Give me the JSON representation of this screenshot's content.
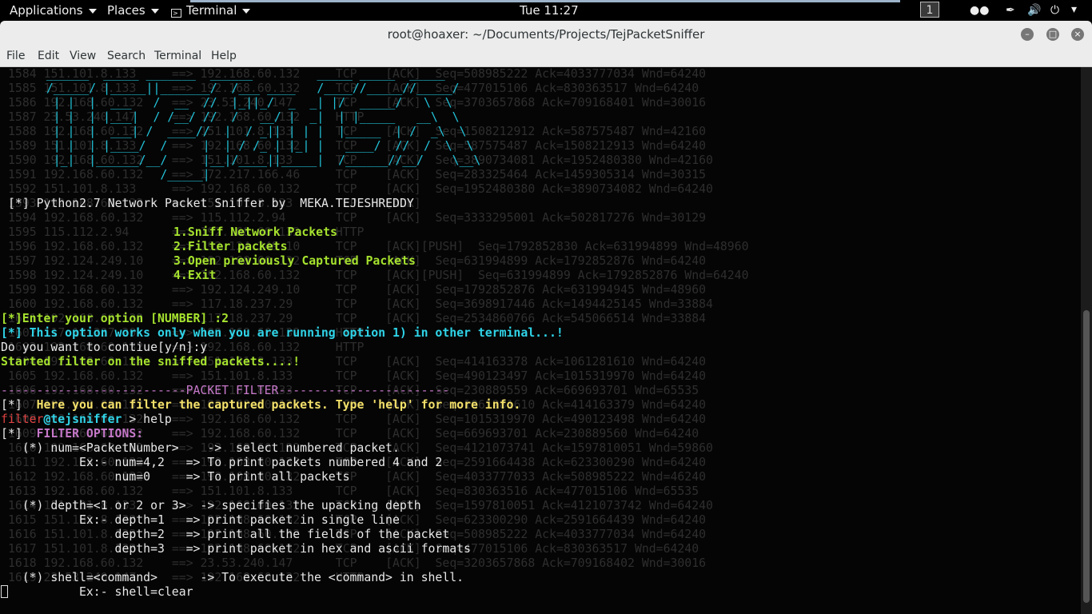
{
  "topbar": {
    "applications": "Applications",
    "places": "Places",
    "terminal": "Terminal",
    "clock": "Tue 11:27",
    "workspace": "1"
  },
  "window": {
    "title": "root@hoaxer: ~/Documents/Projects/TejPacketSniffer",
    "menus": [
      "File",
      "Edit",
      "View",
      "Search",
      "Terminal",
      "Help"
    ]
  },
  "background_rows": [
    "1584 151.101.8.133     ==> 192.168.60.132     TCP    [ACK]  Seq=508985222 Ack=4033777034 Wnd=64240",
    "1585 151.101.8.133     ==> 192.168.60.132     TCP    [ACK]  Seq=477015106 Ack=830363517 Wnd=64240",
    "1586 192.168.60.132    ==> 23.53.240.147      TCP    [ACK]  Seq=3703657868 Ack=709168401 Wnd=30016",
    "1587 23.53.240.147     ==> 192.168.60.132     HTTP",
    "1588 192.168.60.132    ==> 151.101.8.133      TCP    [ACK]  Seq=1508212912 Ack=587575487 Wnd=42160",
    "1589 151.101.8.133     ==> 192.168.60.132     TCP    [ACK]  Seq=587575487 Ack=1508212913 Wnd=64240",
    "1590 192.168.60.132    ==> 151.101.8.133      TCP    [ACK]  Seq=3890734081 Ack=1952480380 Wnd=42160",
    "1591 192.168.60.132    ==> 172.217.166.46     TCP    [ACK]  Seq=283325464 Ack=1459305314 Wnd=30315",
    "1592 151.101.8.133     ==> 192.168.60.132     TCP    [ACK]  Seq=1952480380 Ack=3890734082 Wnd=64240",
    "1593 192.168.60.132    ==> 151.101.8.133      TCP    [ACK]",
    "1594 192.168.60.132    ==> 115.112.2.94       TCP    [ACK]  Seq=3333295001 Ack=502817276 Wnd=30129",
    "1595 115.112.2.94      ==> 192.168.60.132     HTTP",
    "1596 192.168.60.132    ==> 192.124.249.10     TCP    [ACK][PUSH]  Seq=1792852830 Ack=631994899 Wnd=48960",
    "1597 192.124.249.10    ==> 192.168.60.132     TCP    [ACK]  Seq=631994899 Ack=1792852876 Wnd=64240",
    "1598 192.124.249.10    ==> 192.168.60.132     TCP    [ACK][PUSH]  Seq=631994899 Ack=1792852876 Wnd=64240",
    "1599 192.168.60.132    ==> 192.124.249.10     TCP    [ACK]  Seq=1792852876 Ack=631994945 Wnd=48960",
    "1600 192.168.60.132    ==> 117.18.237.29      TCP    [ACK]  Seq=3698917446 Ack=1494425145 Wnd=33884",
    "1601 192.168.60.132    ==> 117.18.237.29      TCP    [ACK]  Seq=2534860766 Ack=545066514 Wnd=33884",
    "1602 117.18.237.29     ==> 192.168.60.132     HTTP",
    "1603 192.168.60.132    ==> 192.168.60.132     HTTP",
    "1604 192.168.60.132    ==> 151.101.8.133      TCP    [ACK]  Seq=414163378 Ack=1061281610 Wnd=64240",
    "1605 192.168.60.132    ==> 151.101.8.133      TCP    [ACK]  Seq=490123497 Ack=1015319970 Wnd=64240",
    "1606 192.168.60.132    ==> 151.101.8.133      TCP    [ACK]  Seq=230889559 Ack=669693701 Wnd=65535",
    "1607 192.168.60.132    ==> 192.168.60.132     TCP    [ACK]  Seq=1061281610 Ack=414163379 Wnd=64240",
    "1608 192.168.60.132    ==> 192.168.60.132     TCP    [ACK]  Seq=1015319970 Ack=490123498 Wnd=64240",
    "1609 192.168.60.132    ==> 192.168.60.132     TCP    [ACK]  Seq=669693701 Ack=230889560 Wnd=64240",
    "1610 192.168.60.132    ==> 192.168.60.132     TCP    [ACK]  Seq=4121073741 Ack=1597810051 Wnd=59860",
    "1611 192.168.60.132    ==> 192.168.60.132     TCP    [ACK]  Seq=2591664438 Ack=623300290 Wnd=64240",
    "1612 192.168.60.132    ==> 192.168.60.132     TCP    [ACK]  Seq=4033777033 Ack=508985222 Wnd=46240",
    "1613 192.168.60.132    ==> 151.101.8.133      TCP    [ACK]  Seq=830363516 Ack=477015106 Wnd=65535",
    "1614 151.101.8.133     ==> 192.168.60.132     TCP    [ACK]  Seq=1597810051 Ack=4121073742 Wnd=64240",
    "1615 151.101.8.133     ==> 192.168.60.132     TCP    [ACK]  Seq=623300290 Ack=2591664439 Wnd=64240",
    "1616 151.101.8.133     ==> 192.168.60.132     TCP    [ACK]  Seq=508985222 Ack=4033777034 Wnd=64240",
    "1617 151.101.8.133     ==> 192.168.60.132     TCP    [ACK]  Seq=477015106 Ack=830363517 Wnd=64240",
    "1618 192.168.60.132    ==> 23.53.240.147      TCP    [ACK]  Seq=3203657868 Ack=709168402 Wnd=30016",
    "1619 23.53.240.147     ==> 192.168.60.132     HTTP"
  ],
  "banner_art": [
    "  ______  _____ _______  ______         _____ _____  _____",
    "  /_____/ |_____||_______/  /___ ____   /____//_____//_____/",
    "   | |  |  ___   /  __  //  |_||_/  _  _| |/  _____/   \\  \\",
    "   | |  | |___|  / /__/ //  /   __/ |  _|  | |_____   __\\  \\",
    "   | |  |  ___| /  ____//  |  / _|| | | |  |_____  | /  _\\  \\",
    "   | |  | |____/  /     |  | / /_ | |_| |   ____/  //  /  \\  \\",
    "   |_|  |______/__/     |__|/____||_____|  /______//__/    \\__\\",
    "                  /_____|"
  ],
  "terminal": {
    "banner_line": "[*] Python2.7 Network Packet Sniffer by  MEKA.TEJESHREDDY",
    "menu": [
      "1.Sniff Network Packets",
      "2.Filter packets",
      "3.Open previously Captured Packets",
      "4.Exit"
    ],
    "enter_option": "[*]Enter your option [NUMBER] :2",
    "option_warning": "[*] This option works only when you are running option 1) in other terminal...!",
    "continue_prompt": "Do you want to contiue[y/n]:y",
    "started_filter": "Started filter on the sniffed packets....!",
    "packet_filter_banner": "--------------------------PACKET FILTER------------------------",
    "info_prefix": "[*]",
    "info_text": "Here you can filter the captured packets. Type 'help' for more info.",
    "prompt_user": "filter",
    "prompt_host": "@tejsniffer",
    "prompt_cmd": " > help",
    "options_prefix": "[*]",
    "options_title": "FILTER OPTIONS:",
    "help_lines": [
      "   (*) num=<PacketNumber>    ->  select numbered packet.",
      "           Ex:- num=4,2   => To print packets numbered 4 and 2",
      "                num=0     => To print all packets",
      "",
      "   (*) depth=<1 or 2 or 3>  -> specifies the upacking depth",
      "           Ex:- depth=1   => print packet in single line",
      "                depth=2   => print all the fields of the packet",
      "                depth=3   => print packet in hex and ascii formats",
      "",
      "   (*) shell=<command>      -> To execute the <command> in shell.",
      "           Ex:- shell=clear"
    ]
  }
}
